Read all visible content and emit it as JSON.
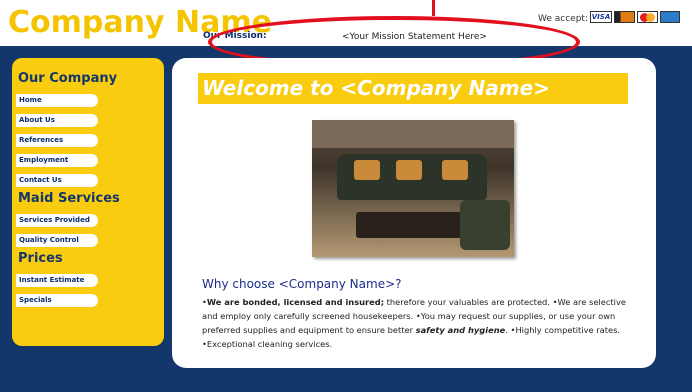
{
  "header": {
    "company_name": "Company Name",
    "mission_label": "Our Mission:",
    "mission_text": "<Your Mission Statement Here>",
    "accept_label": "We accept:",
    "cards": [
      "VISA",
      "Discover",
      "MasterCard",
      "American Express"
    ]
  },
  "annotation_color": "#e2101e",
  "sidebar": {
    "our_company_title": "Our Company",
    "our_company_items": [
      "Home",
      "About Us",
      "References",
      "Employment",
      "Contact Us"
    ],
    "maid_services_title": "Maid Services",
    "maid_services_items": [
      "Services Provided",
      "Quality Control"
    ],
    "prices_title": "Prices",
    "prices_items": [
      "Instant Estimate",
      "Specials"
    ]
  },
  "main": {
    "welcome": "Welcome to <Company Name>",
    "why_title": "Why choose <Company Name>?",
    "bullet_1_bold": "We are bonded, licensed and insured;",
    "bullet_1_rest": " therefore your valuables are protected.",
    "bullet_2": "We are selective and employ only carefully screened housekeepers.",
    "bullet_3_start": "You may request our supplies, or use your own preferred supplies and equipment to ensure better ",
    "bullet_3_emph": "safety and hygiene",
    "bullet_3_end": ".",
    "bullet_4": "Highly competitive rates.",
    "bullet_5": "Exceptional cleaning services."
  },
  "colors": {
    "background": "#13376a",
    "accent_yellow": "#f9cc10",
    "nav_text": "#0b2d6b"
  }
}
